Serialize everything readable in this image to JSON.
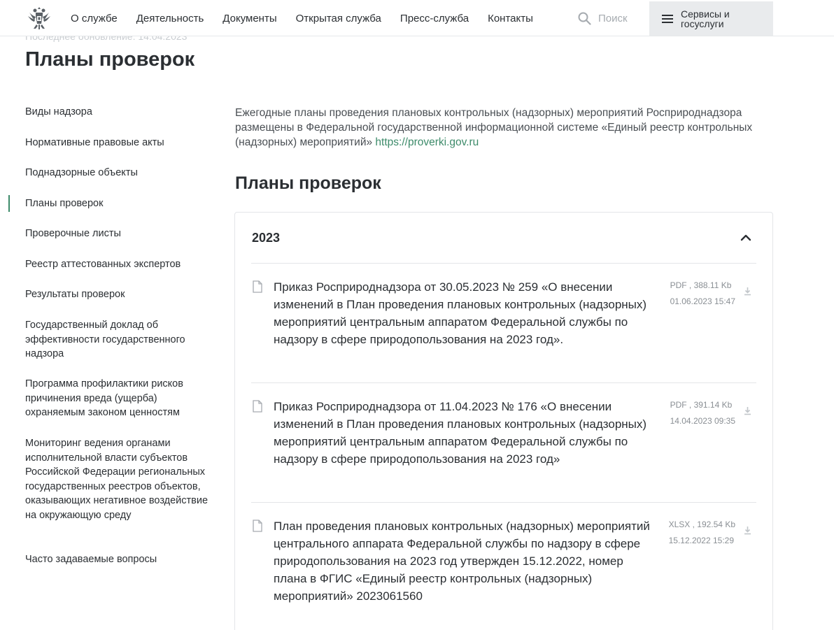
{
  "header": {
    "nav": [
      "О службе",
      "Деятельность",
      "Документы",
      "Открытая служба",
      "Пресс-служба",
      "Контакты"
    ],
    "search_label": "Поиск",
    "services_label": "Сервисы и госуслуги"
  },
  "page": {
    "updated": "Последнее обновление: 14.04.2023",
    "title": "Планы проверок"
  },
  "sidebar": {
    "items": [
      "Виды надзора",
      "Нормативные правовые акты",
      "Поднадзорные объекты",
      "Планы проверок",
      "Проверочные листы",
      "Реестр аттестованных экспертов",
      "Результаты проверок",
      "Государственный доклад об эффективности государственного надзора",
      "Программа профилактики рисков причинения вреда (ущерба) охраняемым законом ценностям",
      "Мониторинг ведения органами исполнительной власти субъектов Российской Федерации региональных государственных реестров объектов, оказывающих негативное воздействие на окружающую среду",
      "Часто задаваемые вопросы"
    ],
    "active_index": 3
  },
  "main": {
    "intro_text": "Ежегодные планы проведения плановых контрольных (надзорных) мероприятий Росприроднадзора размещены в Федеральной государственной информационной системе «Единый реестр контрольных (надзорных) мероприятий»",
    "intro_link": "https://proverki.gov.ru",
    "section_title": "Планы проверок",
    "accordion": {
      "year": "2023",
      "expanded": true,
      "docs": [
        {
          "title": "Приказ Росприроднадзора от 30.05.2023 № 259 «О внесении изменений в План проведения плановых контрольных (надзорных) мероприятий центральным аппаратом Федеральной службы по надзору в сфере природопользования на 2023 год».",
          "format": "PDF , 388.11 Kb",
          "date": "01.06.2023 15:47"
        },
        {
          "title": "Приказ Росприроднадзора от 11.04.2023 № 176 «О внесении изменений в План проведения плановых контрольных (надзорных) мероприятий центральным аппаратом Федеральной службы по надзору в сфере природопользования на 2023 год»",
          "format": "PDF , 391.14 Kb",
          "date": "14.04.2023 09:35"
        },
        {
          "title": "План проведения плановых контрольных (надзорных) мероприятий центрального аппарата Федеральной службы по надзору в сфере природопользования на 2023 год утвержден 15.12.2022, номер плана в ФГИС «Единый реестр контрольных (надзорных) мероприятий» 2023061560",
          "format": "XLSX , 192.54 Kb",
          "date": "15.12.2022 15:29"
        }
      ]
    }
  },
  "colors": {
    "accent": "#3d8b6a",
    "text": "#2b2f33",
    "muted": "#8a8f94",
    "services_bg": "#e9ebed"
  }
}
